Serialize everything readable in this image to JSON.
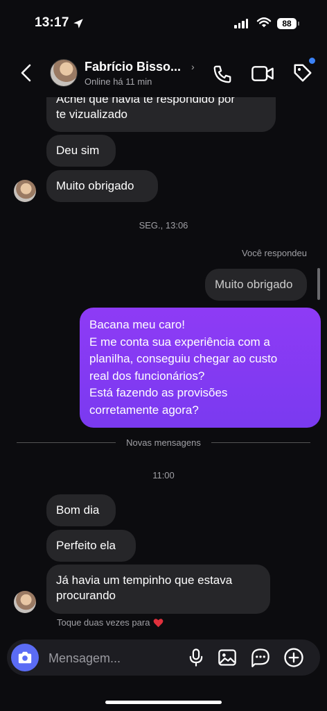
{
  "status_bar": {
    "time": "13:17",
    "battery": "88"
  },
  "header": {
    "contact_name": "Fabrício Bisso...",
    "status": "Online há 11 min"
  },
  "messages": {
    "m1_line1": "Achei que havia te respondido por",
    "m1_line2": "te vizualizado",
    "m2": "Deu sim",
    "m3": "Muito obrigado",
    "date_sep": "SEG., 13:06",
    "you_replied": "Você respondeu",
    "reply_quote": "Muito obrigado",
    "purple_lines": [
      "Bacana meu caro!",
      "E me conta sua experiência com a",
      "planilha, conseguiu chegar ao custo",
      "real dos funcionários?",
      "Está fazendo as provisões",
      "corretamente agora?"
    ],
    "new_messages": "Novas mensagens",
    "time_sep": "11:00",
    "m4": "Bom dia",
    "m5": "Perfeito ela",
    "m6_line1": "Já havia um tempinho que estava",
    "m6_line2": "procurando",
    "double_tap": "Toque duas vezes para"
  },
  "composer": {
    "placeholder": "Mensagem..."
  },
  "icons": {
    "back": "chevron-left-icon",
    "phone": "phone-icon",
    "video": "video-icon",
    "tag": "tag-icon",
    "camera": "camera-icon",
    "mic": "mic-icon",
    "gallery": "image-icon",
    "sticker": "chat-bubble-icon",
    "plus": "plus-circle-icon",
    "heart": "heart-icon"
  },
  "colors": {
    "accent_purple": "#8e3bf5",
    "camera_blue": "#5b6cf5",
    "heart": "#e0303c",
    "dot_blue": "#3b82f6"
  }
}
